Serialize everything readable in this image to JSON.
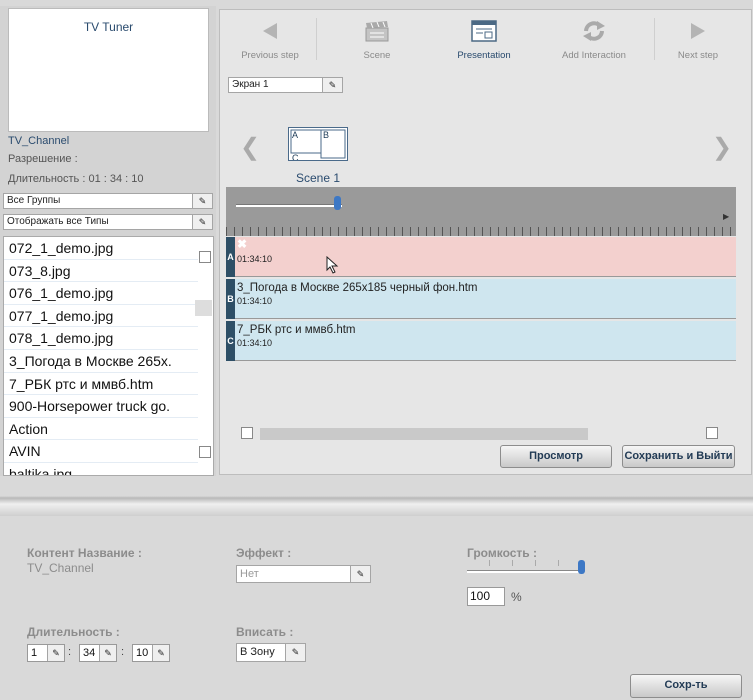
{
  "preview": {
    "title": "TV Tuner",
    "channel": "TV_Channel",
    "resolution": "Разрешение :",
    "duration": "Длительность : 01 : 34 : 10"
  },
  "filters": {
    "group": "Все Группы",
    "type": "Отображать все Типы"
  },
  "files": [
    "072_1_demo.jpg",
    "073_8.jpg",
    "076_1_demo.jpg",
    "077_1_demo.jpg",
    "078_1_demo.jpg",
    "3_Погода в Москве 265x.",
    "7_РБК ртс и ммвб.htm",
    "900-Horsepower truck go.",
    "Action",
    "AVIN",
    "baltika.jpg"
  ],
  "toolbar": {
    "previous": "Previous step",
    "scene": "Scene",
    "presentation": "Presentation",
    "add_interaction": "Add Interaction",
    "next": "Next step"
  },
  "screen_select": "Экран 1",
  "scene": {
    "label": "Scene 1",
    "regions": [
      "A",
      "B",
      "C"
    ]
  },
  "tracks": [
    {
      "letter": "A",
      "title": "",
      "time": "01:34:10"
    },
    {
      "letter": "B",
      "title": "3_Погода в Москве 265х185 черный фон.htm",
      "time": "01:34:10"
    },
    {
      "letter": "C",
      "title": "7_РБК ртс и ммвб.htm",
      "time": "01:34:10"
    }
  ],
  "buttons": {
    "preview": "Просмотр",
    "save_exit": "Сохранить и Выйти",
    "save": "Сохр-ть"
  },
  "properties": {
    "content_name_label": "Контент Название :",
    "content_name_value": "TV_Channel",
    "effect_label": "Эффект :",
    "effect_value": "Нет",
    "volume_label": "Громкость :",
    "volume_value": "100",
    "volume_unit": "%",
    "duration_label": "Длительность :",
    "hours": "1",
    "minutes": "34",
    "seconds": "10",
    "fit_label": "Вписать :",
    "fit_value": "В Зону"
  },
  "colors": {
    "accent": "#2a4b6e",
    "track_active": "#f3d0ce",
    "track": "#cfe6ef",
    "knob": "#3d78c5"
  }
}
